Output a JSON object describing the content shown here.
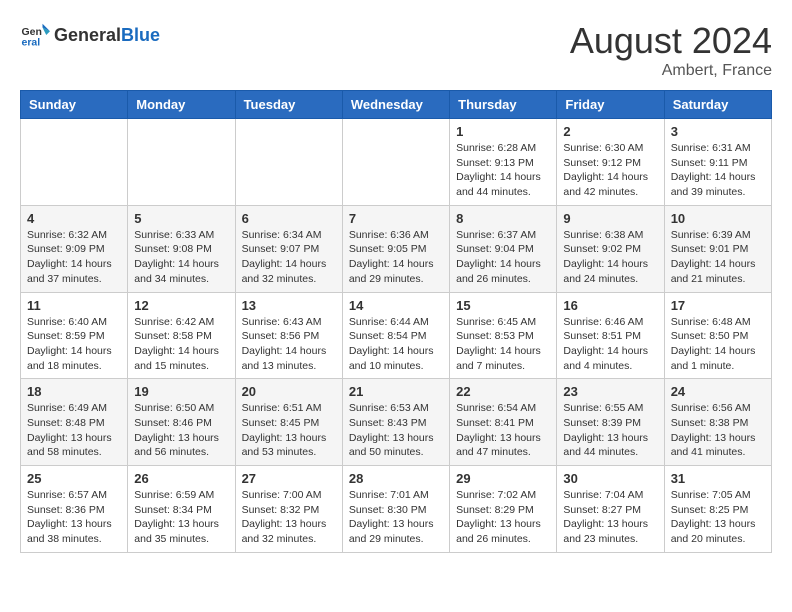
{
  "logo": {
    "general": "General",
    "blue": "Blue"
  },
  "title": {
    "month_year": "August 2024",
    "location": "Ambert, France"
  },
  "weekdays": [
    "Sunday",
    "Monday",
    "Tuesday",
    "Wednesday",
    "Thursday",
    "Friday",
    "Saturday"
  ],
  "weeks": [
    [
      {
        "day": "",
        "info": ""
      },
      {
        "day": "",
        "info": ""
      },
      {
        "day": "",
        "info": ""
      },
      {
        "day": "",
        "info": ""
      },
      {
        "day": "1",
        "info": "Sunrise: 6:28 AM\nSunset: 9:13 PM\nDaylight: 14 hours and 44 minutes."
      },
      {
        "day": "2",
        "info": "Sunrise: 6:30 AM\nSunset: 9:12 PM\nDaylight: 14 hours and 42 minutes."
      },
      {
        "day": "3",
        "info": "Sunrise: 6:31 AM\nSunset: 9:11 PM\nDaylight: 14 hours and 39 minutes."
      }
    ],
    [
      {
        "day": "4",
        "info": "Sunrise: 6:32 AM\nSunset: 9:09 PM\nDaylight: 14 hours and 37 minutes."
      },
      {
        "day": "5",
        "info": "Sunrise: 6:33 AM\nSunset: 9:08 PM\nDaylight: 14 hours and 34 minutes."
      },
      {
        "day": "6",
        "info": "Sunrise: 6:34 AM\nSunset: 9:07 PM\nDaylight: 14 hours and 32 minutes."
      },
      {
        "day": "7",
        "info": "Sunrise: 6:36 AM\nSunset: 9:05 PM\nDaylight: 14 hours and 29 minutes."
      },
      {
        "day": "8",
        "info": "Sunrise: 6:37 AM\nSunset: 9:04 PM\nDaylight: 14 hours and 26 minutes."
      },
      {
        "day": "9",
        "info": "Sunrise: 6:38 AM\nSunset: 9:02 PM\nDaylight: 14 hours and 24 minutes."
      },
      {
        "day": "10",
        "info": "Sunrise: 6:39 AM\nSunset: 9:01 PM\nDaylight: 14 hours and 21 minutes."
      }
    ],
    [
      {
        "day": "11",
        "info": "Sunrise: 6:40 AM\nSunset: 8:59 PM\nDaylight: 14 hours and 18 minutes."
      },
      {
        "day": "12",
        "info": "Sunrise: 6:42 AM\nSunset: 8:58 PM\nDaylight: 14 hours and 15 minutes."
      },
      {
        "day": "13",
        "info": "Sunrise: 6:43 AM\nSunset: 8:56 PM\nDaylight: 14 hours and 13 minutes."
      },
      {
        "day": "14",
        "info": "Sunrise: 6:44 AM\nSunset: 8:54 PM\nDaylight: 14 hours and 10 minutes."
      },
      {
        "day": "15",
        "info": "Sunrise: 6:45 AM\nSunset: 8:53 PM\nDaylight: 14 hours and 7 minutes."
      },
      {
        "day": "16",
        "info": "Sunrise: 6:46 AM\nSunset: 8:51 PM\nDaylight: 14 hours and 4 minutes."
      },
      {
        "day": "17",
        "info": "Sunrise: 6:48 AM\nSunset: 8:50 PM\nDaylight: 14 hours and 1 minute."
      }
    ],
    [
      {
        "day": "18",
        "info": "Sunrise: 6:49 AM\nSunset: 8:48 PM\nDaylight: 13 hours and 58 minutes."
      },
      {
        "day": "19",
        "info": "Sunrise: 6:50 AM\nSunset: 8:46 PM\nDaylight: 13 hours and 56 minutes."
      },
      {
        "day": "20",
        "info": "Sunrise: 6:51 AM\nSunset: 8:45 PM\nDaylight: 13 hours and 53 minutes."
      },
      {
        "day": "21",
        "info": "Sunrise: 6:53 AM\nSunset: 8:43 PM\nDaylight: 13 hours and 50 minutes."
      },
      {
        "day": "22",
        "info": "Sunrise: 6:54 AM\nSunset: 8:41 PM\nDaylight: 13 hours and 47 minutes."
      },
      {
        "day": "23",
        "info": "Sunrise: 6:55 AM\nSunset: 8:39 PM\nDaylight: 13 hours and 44 minutes."
      },
      {
        "day": "24",
        "info": "Sunrise: 6:56 AM\nSunset: 8:38 PM\nDaylight: 13 hours and 41 minutes."
      }
    ],
    [
      {
        "day": "25",
        "info": "Sunrise: 6:57 AM\nSunset: 8:36 PM\nDaylight: 13 hours and 38 minutes."
      },
      {
        "day": "26",
        "info": "Sunrise: 6:59 AM\nSunset: 8:34 PM\nDaylight: 13 hours and 35 minutes."
      },
      {
        "day": "27",
        "info": "Sunrise: 7:00 AM\nSunset: 8:32 PM\nDaylight: 13 hours and 32 minutes."
      },
      {
        "day": "28",
        "info": "Sunrise: 7:01 AM\nSunset: 8:30 PM\nDaylight: 13 hours and 29 minutes."
      },
      {
        "day": "29",
        "info": "Sunrise: 7:02 AM\nSunset: 8:29 PM\nDaylight: 13 hours and 26 minutes."
      },
      {
        "day": "30",
        "info": "Sunrise: 7:04 AM\nSunset: 8:27 PM\nDaylight: 13 hours and 23 minutes."
      },
      {
        "day": "31",
        "info": "Sunrise: 7:05 AM\nSunset: 8:25 PM\nDaylight: 13 hours and 20 minutes."
      }
    ]
  ]
}
